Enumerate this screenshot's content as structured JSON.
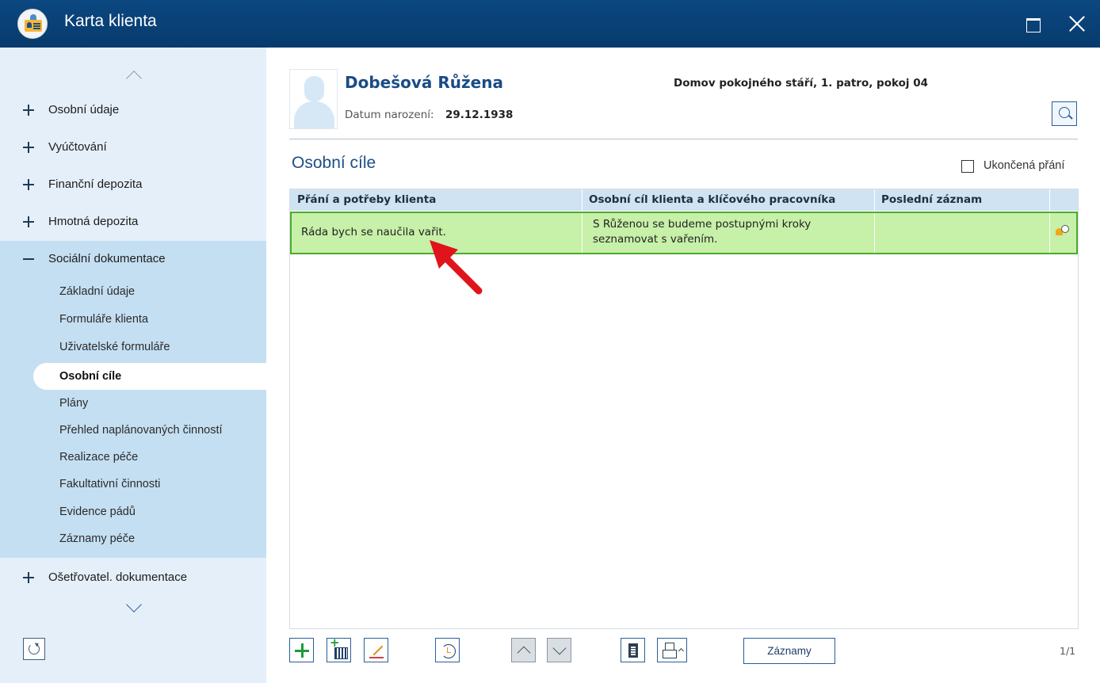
{
  "window": {
    "title": "Karta klienta"
  },
  "sidebar": {
    "items": [
      {
        "label": "Osobní údaje",
        "expanded": false
      },
      {
        "label": "Vyúčtování",
        "expanded": false
      },
      {
        "label": "Finanční depozita",
        "expanded": false
      },
      {
        "label": "Hmotná depozita",
        "expanded": false
      },
      {
        "label": "Sociální dokumentace",
        "expanded": true
      },
      {
        "label": "Ošetřovatel. dokumentace",
        "expanded": false
      }
    ],
    "subitems": [
      "Základní údaje",
      "Formuláře klienta",
      "Uživatelské formuláře",
      "Osobní cíle",
      "Plány",
      "Přehled naplánovaných činností",
      "Realizace péče",
      "Fakultativní činnosti",
      "Evidence pádů",
      "Záznamy péče"
    ],
    "active_subitem": "Osobní cíle"
  },
  "client": {
    "name": "Dobešová Růžena",
    "dob_label": "Datum narození:",
    "dob_value": "29.12.1938",
    "facility": "Domov pokojného stáří, 1. patro, pokoj 04"
  },
  "section": {
    "title": "Osobní cíle",
    "checkbox_label": "Ukončená přání",
    "checkbox_checked": false
  },
  "table": {
    "columns": [
      "Přání a potřeby klienta",
      "Osobní cíl klienta a klíčového pracovníka",
      "Poslední záznam"
    ],
    "rows": [
      {
        "wish": "Ráda bych se naučila vařit.",
        "goal_line1": "S Růženou se budeme postupnými kroky",
        "goal_line2": "seznamovat s vařením.",
        "last_record": "",
        "selected": true
      }
    ]
  },
  "toolbar": {
    "records_label": "Záznamy",
    "pager": "1/1"
  },
  "colors": {
    "titlebar": "#0b4780",
    "sidebar": "#e5eff9",
    "sidebar_expanded": "#c4dff2",
    "accent_text": "#1a4c86",
    "row_selected": "#c7f0a8",
    "row_selected_border": "#4eaa2e",
    "annotation_arrow": "#e0141b"
  }
}
